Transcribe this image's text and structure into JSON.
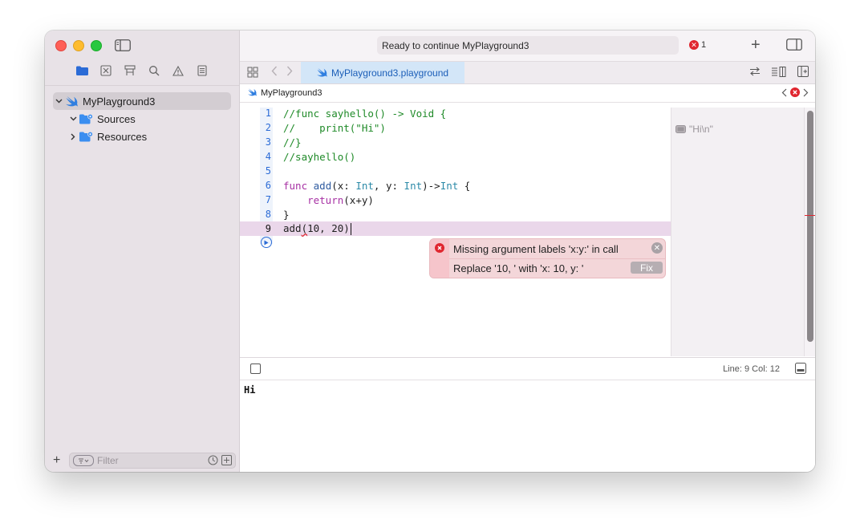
{
  "toolbar": {
    "status": "Ready to continue MyPlayground3",
    "error_count": "1",
    "error_glyph": "✕"
  },
  "tab": {
    "active_label": "MyPlayground3.playground"
  },
  "jumpbar": {
    "path": "MyPlayground3"
  },
  "sidebar": {
    "items": [
      {
        "label": "MyPlayground3",
        "icon": "swift-icon",
        "expanded": true,
        "selected": true
      },
      {
        "label": "Sources",
        "icon": "folder-icon",
        "expanded": true,
        "selected": false
      },
      {
        "label": "Resources",
        "icon": "folder-icon",
        "expanded": false,
        "selected": false
      }
    ],
    "filter_placeholder": "Filter"
  },
  "editor": {
    "line_numbers": [
      "1",
      "2",
      "3",
      "4",
      "5",
      "6",
      "7",
      "8",
      "9"
    ],
    "current_line": "9"
  },
  "results": {
    "value": "\"Hi\\n\""
  },
  "error_popup": {
    "message": "Missing argument labels 'x:y:' in call",
    "suggestion": "Replace '10, ' with 'x: 10, y: '",
    "fix_label": "Fix"
  },
  "debug": {
    "line_col": "Line: 9  Col: 12"
  },
  "console": {
    "output": "Hi"
  },
  "colors": {
    "accent": "#2b6bd6",
    "error": "#e0262f",
    "current_line_bg": "#ead7ea",
    "tab_active_bg": "#d3e6f8"
  }
}
